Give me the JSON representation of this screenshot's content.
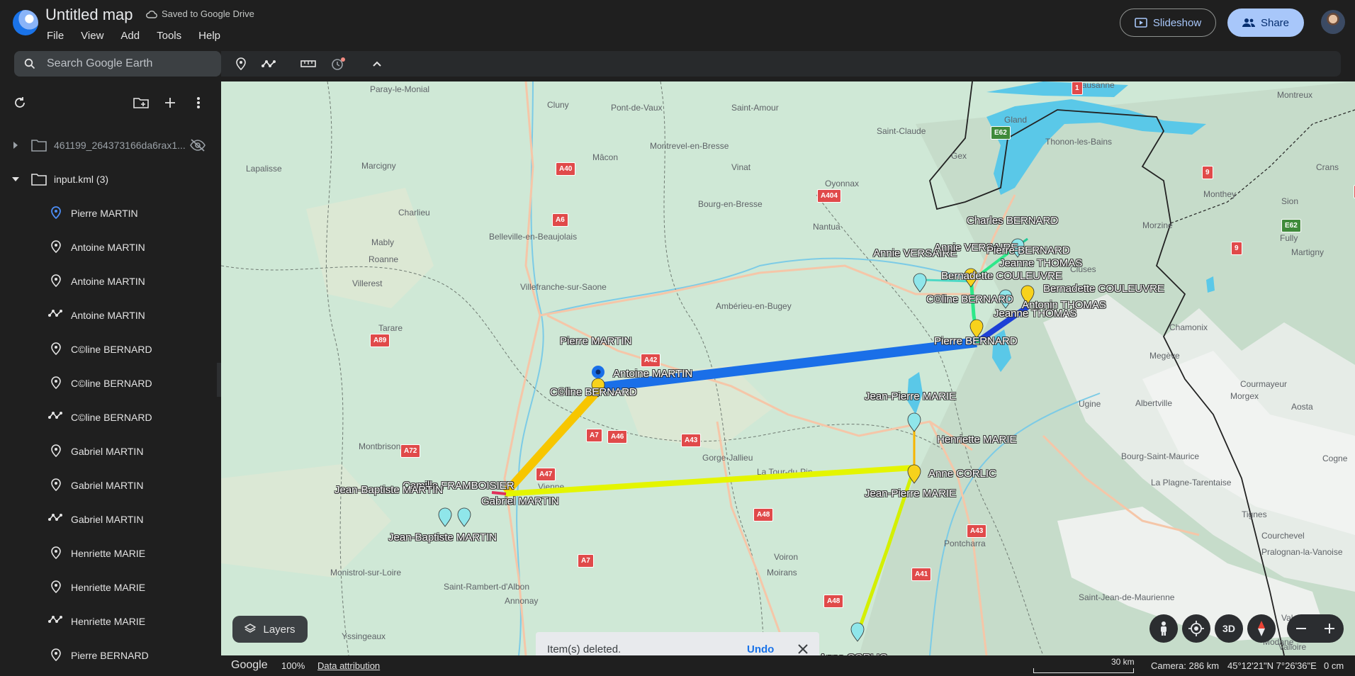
{
  "app": {
    "title": "Untitled map",
    "saved_status": "Saved to Google Drive",
    "menu": [
      "File",
      "View",
      "Add",
      "Tools",
      "Help"
    ],
    "search_placeholder": "Search Google Earth",
    "slideshow_label": "Slideshow",
    "share_label": "Share"
  },
  "sidebar": {
    "folders": [
      {
        "label": "461199_264373166da6rax1...",
        "expanded": false,
        "hidden": true
      },
      {
        "label": "input.kml (3)",
        "expanded": true
      }
    ],
    "items": [
      {
        "label": "Pierre MARTIN",
        "icon": "placemark-blue-icon"
      },
      {
        "label": "Antoine MARTIN",
        "icon": "placemark-icon"
      },
      {
        "label": "Antoine MARTIN",
        "icon": "placemark-icon"
      },
      {
        "label": "Antoine MARTIN",
        "icon": "path-icon"
      },
      {
        "label": "C©line BERNARD",
        "icon": "placemark-icon"
      },
      {
        "label": "C©line BERNARD",
        "icon": "placemark-icon"
      },
      {
        "label": "C©line BERNARD",
        "icon": "path-icon"
      },
      {
        "label": "Gabriel MARTIN",
        "icon": "placemark-icon"
      },
      {
        "label": "Gabriel MARTIN",
        "icon": "placemark-icon"
      },
      {
        "label": "Gabriel MARTIN",
        "icon": "path-icon"
      },
      {
        "label": "Henriette MARIE",
        "icon": "placemark-icon"
      },
      {
        "label": "Henriette MARIE",
        "icon": "placemark-icon"
      },
      {
        "label": "Henriette MARIE",
        "icon": "path-icon"
      },
      {
        "label": "Pierre BERNARD",
        "icon": "placemark-icon"
      }
    ]
  },
  "map": {
    "places": [
      "Paray-le-Monial",
      "Cluny",
      "Pont-de-Vaux",
      "Saint-Amour",
      "Lausanne",
      "Montreux",
      "Saint-Claude",
      "Gland",
      "Thonon-les-Bains",
      "Gex",
      "Lapalisse",
      "Marcigny",
      "Mâcon",
      "Montrevel-en-Bresse",
      "Vinat",
      "Oyonnax",
      "Bourg-en-Bresse",
      "Charlieu",
      "Mably",
      "Roanne",
      "Belleville-en-Beaujolais",
      "Nantua",
      "Morzine",
      "Monthey",
      "Fully",
      "Sion",
      "Martigny",
      "Villerest",
      "Villefranche-sur-Saone",
      "Ambérieu-en-Bugey",
      "Cluses",
      "Tarare",
      "Chamonix",
      "Megève",
      "Montbrison",
      "Courmayeur",
      "Morgex",
      "Aosta",
      "Ugine",
      "Albertville",
      "Bourg-Saint-Maurice",
      "Cogne",
      "La Plagne-Tarentaise",
      "Tignes",
      "Vienne",
      "Gorge-Jallieu",
      "La Tour-du-Pin",
      "Courchevel",
      "Pralognan-la-Vanoise",
      "Pontcharra",
      "Monistrol-sur-Loire",
      "Saint-Rambert-d'Albon",
      "Annonay",
      "Voiron",
      "Moirans",
      "Saint-Jean-de-Maurienne",
      "Val-Cenis",
      "Modane",
      "Valloire",
      "Yssingeaux",
      "Crans"
    ],
    "routes": [
      "A40",
      "A6",
      "A404",
      "A89",
      "A42",
      "A7",
      "A46",
      "A43",
      "A72",
      "A47",
      "A48",
      "A41",
      "A43",
      "A7",
      "A48",
      "E62",
      "E62",
      "9",
      "9",
      "9",
      "1"
    ],
    "placemark_labels": [
      "Charles BERNARD",
      "Annie VERSAIRE",
      "Annie VERSAIRE",
      "Pierre BERNARD",
      "Jeanne THOMAS",
      "Bernadette COULEUVRE",
      "C©line BERNARD",
      "Bernadette COULEUVRE",
      "Antonin THOMAS",
      "Jeanne THOMAS",
      "Pierre BERNARD",
      "Pierre MARTIN",
      "Antoine MARTIN",
      "C©line BERNARD",
      "Jean-Pierre MARIE",
      "Henriette MARIE",
      "Anne CORLIC",
      "Jean-Pierre MARIE",
      "Camille FRAMBOISIER",
      "Jean-Baptiste MARTIN",
      "Gabriel MARTIN",
      "Jean-Baptiste MARTIN",
      "Anne CORLIC"
    ],
    "layers_label": "Layers",
    "view_3d_label": "3D",
    "toast": {
      "message": "Item(s) deleted.",
      "action": "Undo"
    }
  },
  "status": {
    "brand": "Google",
    "zoom": "100%",
    "attribution": "Data attribution",
    "scale": "30 km",
    "camera": "Camera: 286 km",
    "coords": "45°12'21\"N 7°26'36\"E",
    "elevation": "0 cm"
  },
  "colors": {
    "accent": "#a8c7fa",
    "route_blue": "#1a6fe8",
    "route_yellow": "#f7c600",
    "route_lime": "#e4f500",
    "route_green": "#2ee88a",
    "route_darkblue": "#1d3fd6"
  }
}
